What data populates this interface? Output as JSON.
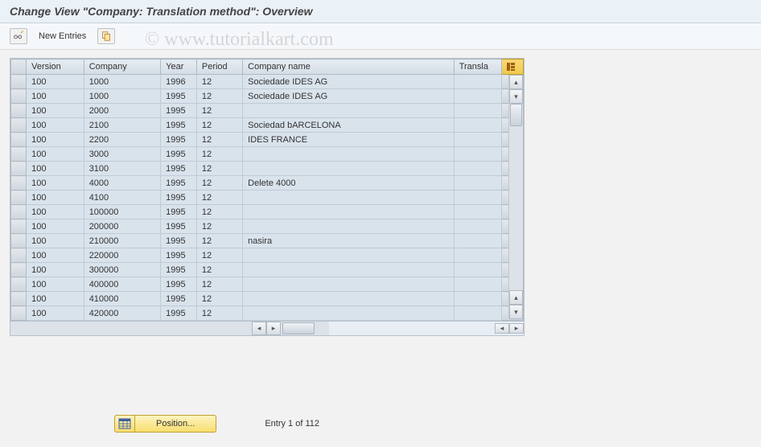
{
  "title": "Change View \"Company: Translation method\": Overview",
  "toolbar": {
    "new_entries_label": "New Entries"
  },
  "watermark": "© www.tutorialkart.com",
  "table": {
    "columns": [
      "Version",
      "Company",
      "Year",
      "Period",
      "Company name",
      "Transla"
    ],
    "rows": [
      {
        "version": "100",
        "company": "1000",
        "year": "1996",
        "period": "12",
        "name": "Sociedade IDES AG",
        "transl": ""
      },
      {
        "version": "100",
        "company": "1000",
        "year": "1995",
        "period": "12",
        "name": "Sociedade IDES AG",
        "transl": ""
      },
      {
        "version": "100",
        "company": "2000",
        "year": "1995",
        "period": "12",
        "name": "",
        "transl": ""
      },
      {
        "version": "100",
        "company": "2100",
        "year": "1995",
        "period": "12",
        "name": "Sociedad bARCELONA",
        "transl": ""
      },
      {
        "version": "100",
        "company": "2200",
        "year": "1995",
        "period": "12",
        "name": "IDES FRANCE",
        "transl": ""
      },
      {
        "version": "100",
        "company": "3000",
        "year": "1995",
        "period": "12",
        "name": "",
        "transl": ""
      },
      {
        "version": "100",
        "company": "3100",
        "year": "1995",
        "period": "12",
        "name": "",
        "transl": ""
      },
      {
        "version": "100",
        "company": "4000",
        "year": "1995",
        "period": "12",
        "name": "Delete 4000",
        "transl": ""
      },
      {
        "version": "100",
        "company": "4100",
        "year": "1995",
        "period": "12",
        "name": "",
        "transl": ""
      },
      {
        "version": "100",
        "company": "100000",
        "year": "1995",
        "period": "12",
        "name": "",
        "transl": ""
      },
      {
        "version": "100",
        "company": "200000",
        "year": "1995",
        "period": "12",
        "name": "",
        "transl": ""
      },
      {
        "version": "100",
        "company": "210000",
        "year": "1995",
        "period": "12",
        "name": "nasira",
        "transl": ""
      },
      {
        "version": "100",
        "company": "220000",
        "year": "1995",
        "period": "12",
        "name": "",
        "transl": ""
      },
      {
        "version": "100",
        "company": "300000",
        "year": "1995",
        "period": "12",
        "name": "",
        "transl": ""
      },
      {
        "version": "100",
        "company": "400000",
        "year": "1995",
        "period": "12",
        "name": "",
        "transl": ""
      },
      {
        "version": "100",
        "company": "410000",
        "year": "1995",
        "period": "12",
        "name": "",
        "transl": ""
      },
      {
        "version": "100",
        "company": "420000",
        "year": "1995",
        "period": "12",
        "name": "",
        "transl": ""
      }
    ]
  },
  "footer": {
    "position_label": "Position...",
    "entry_info": "Entry 1 of 112"
  }
}
